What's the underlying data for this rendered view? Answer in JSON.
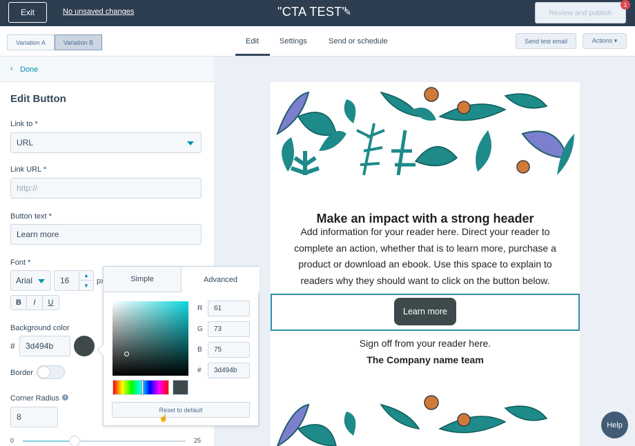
{
  "topbar": {
    "exit_label": "Exit",
    "unsaved_label": "No unsaved changes",
    "doc_title": "\"CTA TEST\"",
    "review_label": "Review and publish",
    "notification_count": "1"
  },
  "toolbar": {
    "variation_a": "Variation A",
    "variation_b": "Variation B",
    "tabs": [
      "Edit",
      "Settings",
      "Send or schedule"
    ],
    "send_test_label": "Send test email",
    "actions_label": "Actions ▾"
  },
  "panel": {
    "done_label": "Done",
    "title": "Edit Button",
    "link_to_label": "Link to *",
    "link_to_value": "URL",
    "link_url_label": "Link URL *",
    "link_url_placeholder": "http://",
    "button_text_label": "Button text *",
    "button_text_value": "Learn more",
    "font_label": "Font *",
    "font_family_value": "Arial",
    "font_size_value": "16",
    "px_label": "px",
    "format_buttons": [
      "B",
      "I",
      "U"
    ],
    "bg_color_label": "Background color",
    "hash_label": "#",
    "bg_color_value": "3d494b",
    "border_label": "Border",
    "corner_radius_label": "Corner Radius",
    "corner_radius_value": "8",
    "slider_min": "0",
    "slider_max": "25",
    "slider_value": 8
  },
  "picker": {
    "tab_simple": "Simple",
    "tab_advanced": "Advanced",
    "r_label": "R",
    "r_value": "61",
    "g_label": "G",
    "g_value": "73",
    "b_label": "B",
    "b_value": "75",
    "hex_label": "#",
    "hex_value": "3d494b",
    "reset_label": "Reset to default"
  },
  "email": {
    "heading": "Make an impact with a strong header",
    "body": "Add information for your reader here. Direct your reader to complete an action, whether that is to learn more, purchase a product or download an ebook. Use this space to explain to readers why they should want to click on the button below.",
    "button_label": "Learn more",
    "signoff": "Sign off from your reader here.",
    "company": "The Company name team"
  },
  "help_label": "Help",
  "colors": {
    "button_bg": "#3d494b",
    "nav_dark": "#2d3e50",
    "link_teal": "#0091ae",
    "leaf_teal": "#1e8a8a",
    "leaf_purple": "#7b7fce",
    "berry_orange": "#d07a3a"
  }
}
